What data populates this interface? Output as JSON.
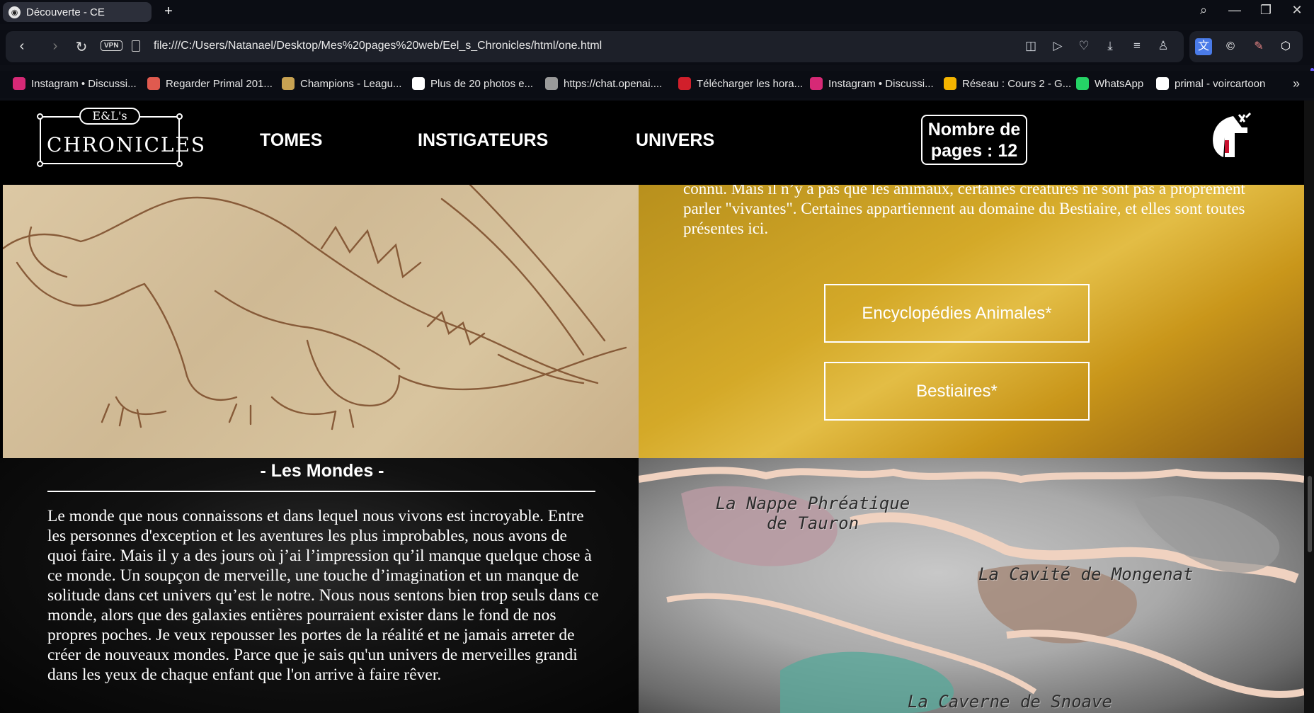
{
  "browser": {
    "tab_title": "Découverte - CE",
    "url": "file:///C:/Users/Natanael/Desktop/Mes%20pages%20web/Eel_s_Chronicles/html/one.html",
    "vpn_label": "VPN",
    "bookmarks": [
      {
        "label": "Instagram • Discussi...",
        "color": "#d62976"
      },
      {
        "label": "Regarder Primal 201...",
        "color": "#e05a4f"
      },
      {
        "label": "Champions - Leagu...",
        "color": "#c8a252"
      },
      {
        "label": "Plus de 20 photos e...",
        "color": "#ffffff"
      },
      {
        "label": "https://chat.openai....",
        "color": "#9a9a9a"
      },
      {
        "label": "Télécharger les hora...",
        "color": "#d11f2b"
      },
      {
        "label": "Instagram • Discussi...",
        "color": "#d62976"
      },
      {
        "label": "Réseau : Cours 2 - G...",
        "color": "#f4b400"
      },
      {
        "label": "WhatsApp",
        "color": "#25d366"
      },
      {
        "label": "primal - voircartoon",
        "color": "#ffffff"
      }
    ]
  },
  "site": {
    "logo_top": "E&L's",
    "logo_main": "CHRONICLES",
    "nav": [
      "TOMES",
      "INSTIGATEURS",
      "UNIVERS"
    ],
    "pages_count": "Nombre de pages : 12"
  },
  "creatures": {
    "text": "connu. Mais il n’y a pas que les animaux, certaines créatures ne sont pas à proprement parler \"vivantes\". Certaines appartiennent au domaine du Bestiaire, et elles sont toutes présentes ici.",
    "buttons": [
      "Encyclopédies Animales*",
      "Bestiaires*"
    ]
  },
  "worlds": {
    "title": "- Les Mondes -",
    "text": "Le monde que nous connaissons et dans lequel nous vivons est incroyable. Entre les personnes d'exception et les aventures les plus improbables, nous avons de quoi faire. Mais il y a des jours où j’ai l’impression qu’il manque quelque chose à ce monde. Un soupçon de merveille, une touche d’imagination et un manque de solitude dans cet univers qu’est le notre. Nous nous sentons bien trop seuls dans ce monde, alors que des galaxies entières pourraient exister dans le fond de nos propres poches. Je veux repousser les portes de la réalité et ne jamais arreter de créer de nouveaux mondes. Parce que je sais qu'un univers de merveilles grandi dans les yeux de chaque enfant que l'on arrive à faire rêver."
  },
  "map": {
    "labels": [
      "La Nappe Phréatique de Tauron",
      "La Cavité de Mongenat",
      "La Caverne de Snoave"
    ]
  }
}
